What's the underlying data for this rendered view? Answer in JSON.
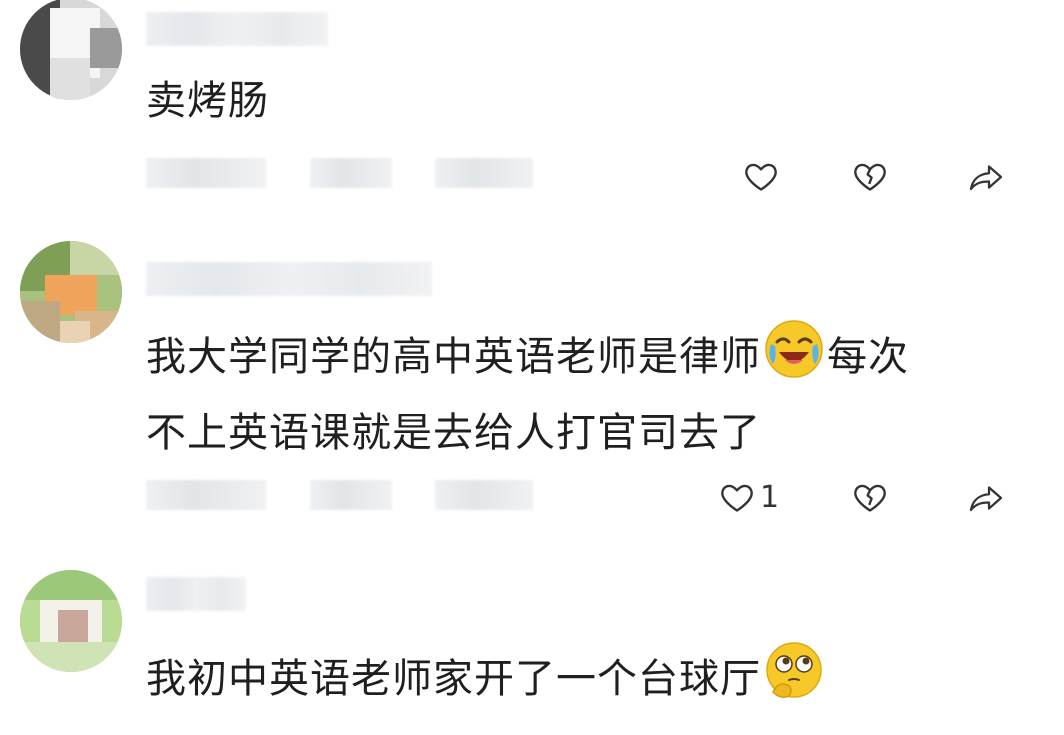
{
  "comments": [
    {
      "text": "卖烤肠",
      "likes": ""
    },
    {
      "text_part1": "我大学同学的高中英语老师是律师",
      "text_part2": "每次",
      "text_line2": "不上英语课就是去给人打官司去了",
      "likes": "1"
    },
    {
      "text": "我初中英语老师家开了一个台球厅",
      "likes": ""
    }
  ],
  "icons": {
    "like": "heart-outline",
    "dislike": "broken-heart-outline",
    "share": "share-arrow",
    "emoji_laugh_cry": "laughing-crying-face",
    "emoji_thinking": "thinking-face"
  },
  "colors": {
    "text": "#1f1f1f",
    "icon": "#333333",
    "emoji_yellow": "#f7c928",
    "blur": "#e6e9ec"
  }
}
